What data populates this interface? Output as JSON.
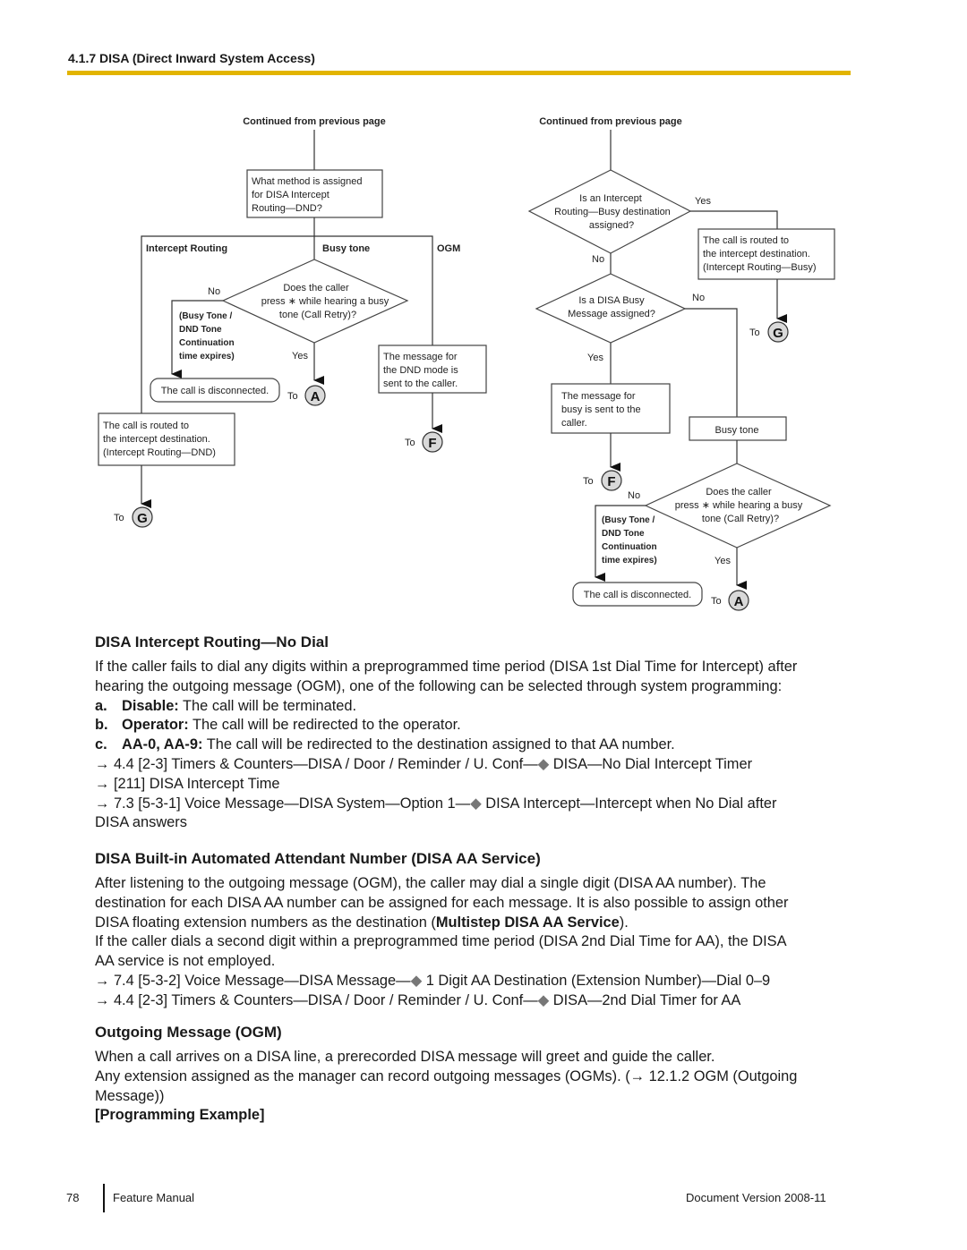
{
  "header": {
    "section_title": "4.1.7 DISA (Direct Inward System Access)"
  },
  "flowchart_left": {
    "continued": "Continued from previous page",
    "question_box": [
      "What method is assigned",
      "for DISA Intercept",
      "Routing—DND?"
    ],
    "branch_intercept": "Intercept Routing",
    "branch_busy": "Busy tone",
    "branch_ogm": "OGM",
    "decision": [
      "Does the caller",
      "press ∗ while hearing a busy",
      "tone (Call Retry)?"
    ],
    "no_label": "No",
    "yes_label": "Yes",
    "timeout_note": [
      "(Busy Tone /",
      "DND Tone",
      "Continuation",
      "time expires)"
    ],
    "disconnected": "The call is disconnected.",
    "routed_box": [
      "The call is routed to",
      "the intercept destination.",
      "(Intercept Routing—DND)"
    ],
    "ogm_box": [
      "The message for",
      "the DND mode is",
      "sent to the caller."
    ],
    "to_label": "To",
    "connector_a": "A",
    "connector_f": "F",
    "connector_g": "G"
  },
  "flowchart_right": {
    "continued": "Continued from previous page",
    "decision1": [
      "Is an Intercept",
      "Routing—Busy destination",
      "assigned?"
    ],
    "yes_label": "Yes",
    "no_label": "No",
    "routed_box": [
      "The call is routed to",
      "the intercept destination.",
      "(Intercept Routing—Busy)"
    ],
    "decision2": [
      "Is a DISA Busy",
      "Message assigned?"
    ],
    "busy_msg_box": [
      "The message for",
      "busy is sent to the",
      "caller."
    ],
    "busy_tone_box": "Busy tone",
    "decision3": [
      "Does the caller",
      "press ∗ while hearing a busy",
      "tone (Call Retry)?"
    ],
    "timeout_note": [
      "(Busy Tone /",
      "DND Tone",
      "Continuation",
      "time expires)"
    ],
    "disconnected": "The call is disconnected.",
    "to_label": "To",
    "connector_a": "A",
    "connector_f": "F",
    "connector_g": "G"
  },
  "no_dial": {
    "title": "DISA Intercept Routing—No Dial",
    "intro": [
      "If the caller fails to dial any digits within a preprogrammed time period (DISA 1st Dial Time for Intercept) after",
      "hearing the outgoing message (OGM), one of the following can be selected through system programming:"
    ],
    "options": [
      {
        "letter": "a.",
        "bold": "Disable:",
        "text": " The call will be terminated."
      },
      {
        "letter": "b.",
        "bold": "Operator:",
        "text": " The call will be redirected to the operator."
      },
      {
        "letter": "c.",
        "bold": "AA-0, AA-9:",
        "text": " The call will be redirected to the destination assigned to that AA number."
      }
    ],
    "refs": [
      {
        "pre": "→ 4.4  [2-3] Timers & Counters—DISA / Door / Reminder / U. Conf—",
        "post": " DISA—No Dial Intercept Timer"
      },
      {
        "pre": "→ [211] DISA Intercept Time",
        "post": ""
      },
      {
        "pre": "→ 7.3  [5-3-1] Voice Message—DISA System—Option 1—",
        "post": " DISA Intercept—Intercept when No Dial after"
      }
    ],
    "refs_cont": "DISA answers"
  },
  "aa_service": {
    "title": "DISA Built-in Automated Attendant Number (DISA AA Service)",
    "p1_line1": "After listening to the outgoing message (OGM), the caller may dial a single digit (DISA AA number). The",
    "p1_line2": "destination for each DISA AA number can be assigned for each message. It is also possible to assign other",
    "p1_line3_pre": "DISA floating extension numbers as the destination (",
    "p1_line3_bold": "Multistep DISA AA Service",
    "p1_line3_post": ").",
    "p2_line1": "If the caller dials a second digit within a preprogrammed time period (DISA 2nd Dial Time for AA), the DISA",
    "p2_line2": "AA service is not employed.",
    "refs": [
      {
        "pre": "→ 7.4  [5-3-2] Voice Message—DISA Message—",
        "post": " 1 Digit AA Destination (Extension Number)—Dial 0–9"
      },
      {
        "pre": "→ 4.4  [2-3] Timers & Counters—DISA / Door / Reminder / U. Conf—",
        "post": " DISA—2nd Dial Timer for AA"
      }
    ]
  },
  "ogm": {
    "title": "Outgoing Message (OGM)",
    "line1": "When a call arrives on a DISA line, a prerecorded DISA message will greet and guide the caller.",
    "line2": "Any extension assigned as the manager can record outgoing messages (OGMs). (→ 12.1.2  OGM (Outgoing",
    "line3": "Message))",
    "programming_example": "[Programming Example]"
  },
  "footer": {
    "page_number": "78",
    "manual_name": "Feature Manual",
    "doc_version": "Document Version  2008-11"
  },
  "diamond_glyph": "◆",
  "accent_color": "#e2b400"
}
